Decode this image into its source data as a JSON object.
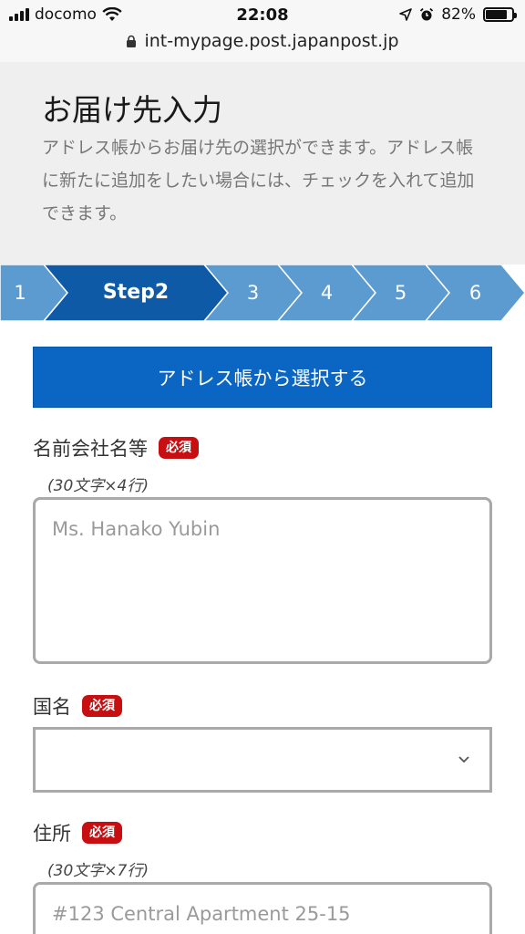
{
  "status_bar": {
    "carrier": "docomo",
    "time": "22:08",
    "battery": "82%",
    "battery_level": 0.82,
    "url": "int-mypage.post.japanpost.jp"
  },
  "header": {
    "title": "お届け先入力",
    "description": "アドレス帳からお届け先の選択ができます。アドレス帳に新たに追加をしたい場合には、チェックを入れて追加できます。"
  },
  "steps": [
    {
      "label": "1",
      "active": false
    },
    {
      "label": "Step2",
      "active": true
    },
    {
      "label": "3",
      "active": false
    },
    {
      "label": "4",
      "active": false
    },
    {
      "label": "5",
      "active": false
    },
    {
      "label": "6",
      "active": false
    }
  ],
  "colors": {
    "step_active": "#0e5aa7",
    "step_inactive": "#5b9bd0",
    "primary_button": "#0a66c2",
    "required_badge": "#c70f12"
  },
  "form": {
    "address_book_button": "アドレス帳から選択する",
    "required_label": "必須",
    "name": {
      "label": "名前会社名等",
      "hint": "(30文字×4行)",
      "placeholder": "Ms. Hanako Yubin",
      "value": ""
    },
    "country": {
      "label": "国名",
      "value": ""
    },
    "address": {
      "label": "住所",
      "hint": "(30文字×7行)",
      "placeholder": "#123 Central Apartment 25-15",
      "value": ""
    }
  }
}
